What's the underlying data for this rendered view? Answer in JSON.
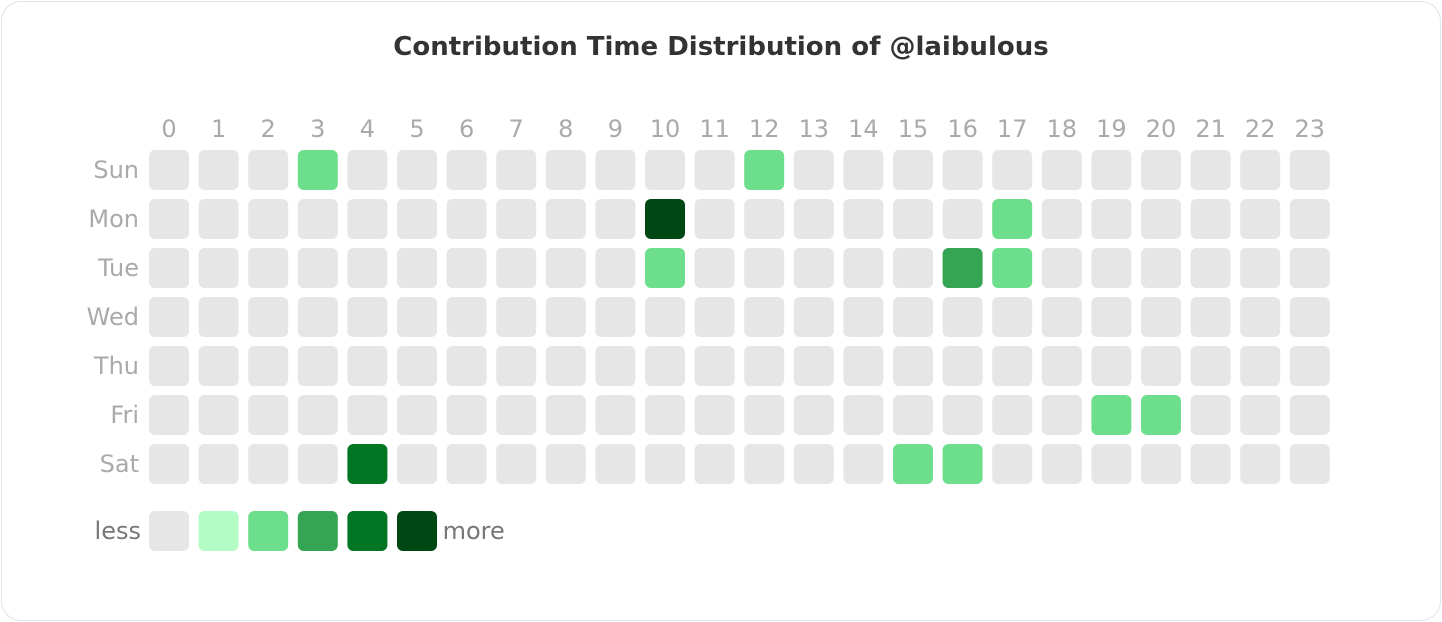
{
  "chart_data": {
    "type": "heatmap",
    "title": "Contribution Time Distribution of @laibulous",
    "x": [
      "0",
      "1",
      "2",
      "3",
      "4",
      "5",
      "6",
      "7",
      "8",
      "9",
      "10",
      "11",
      "12",
      "13",
      "14",
      "15",
      "16",
      "17",
      "18",
      "19",
      "20",
      "21",
      "22",
      "23"
    ],
    "y": [
      "Sun",
      "Mon",
      "Tue",
      "Wed",
      "Thu",
      "Fri",
      "Sat"
    ],
    "levels": [
      [
        0,
        0,
        0,
        2,
        0,
        0,
        0,
        0,
        0,
        0,
        0,
        0,
        2,
        0,
        0,
        0,
        0,
        0,
        0,
        0,
        0,
        0,
        0,
        0
      ],
      [
        0,
        0,
        0,
        0,
        0,
        0,
        0,
        0,
        0,
        0,
        5,
        0,
        0,
        0,
        0,
        0,
        0,
        2,
        0,
        0,
        0,
        0,
        0,
        0
      ],
      [
        0,
        0,
        0,
        0,
        0,
        0,
        0,
        0,
        0,
        0,
        2,
        0,
        0,
        0,
        0,
        0,
        3,
        2,
        0,
        0,
        0,
        0,
        0,
        0
      ],
      [
        0,
        0,
        0,
        0,
        0,
        0,
        0,
        0,
        0,
        0,
        0,
        0,
        0,
        0,
        0,
        0,
        0,
        0,
        0,
        0,
        0,
        0,
        0,
        0
      ],
      [
        0,
        0,
        0,
        0,
        0,
        0,
        0,
        0,
        0,
        0,
        0,
        0,
        0,
        0,
        0,
        0,
        0,
        0,
        0,
        0,
        0,
        0,
        0,
        0
      ],
      [
        0,
        0,
        0,
        0,
        0,
        0,
        0,
        0,
        0,
        0,
        0,
        0,
        0,
        0,
        0,
        0,
        0,
        0,
        0,
        2,
        2,
        0,
        0,
        0
      ],
      [
        0,
        0,
        0,
        0,
        4,
        0,
        0,
        0,
        0,
        0,
        0,
        0,
        0,
        0,
        0,
        2,
        2,
        0,
        0,
        0,
        0,
        0,
        0,
        0
      ]
    ],
    "palette": [
      "#e6e6e6",
      "#b3fcc6",
      "#6ddf8c",
      "#36a553",
      "#007523",
      "#004813"
    ],
    "legend": {
      "less": "less",
      "more": "more",
      "placement": "bottom-left"
    }
  }
}
